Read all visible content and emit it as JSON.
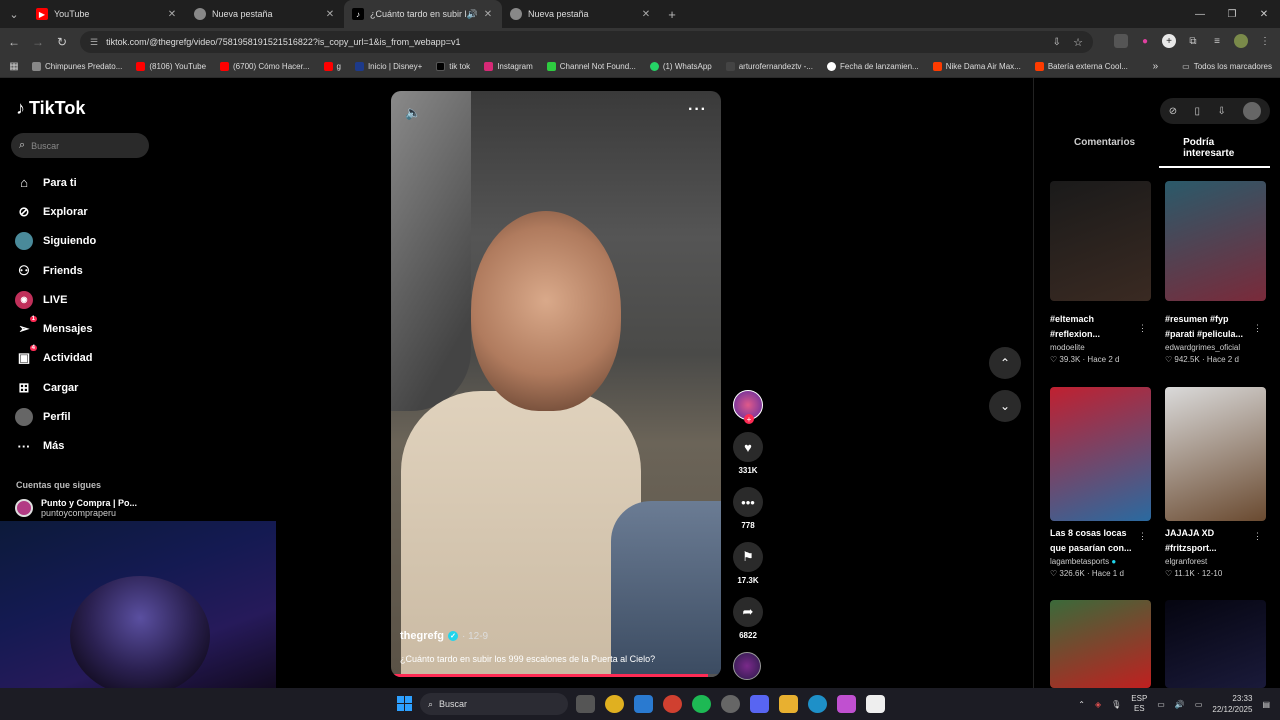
{
  "browser": {
    "tabs": [
      {
        "title": "YouTube",
        "icon": "youtube-icon",
        "active": false
      },
      {
        "title": "Nueva pestaña",
        "icon": "chrome-icon",
        "active": false
      },
      {
        "title": "¿Cuánto tardo en subir los",
        "icon": "tiktok-icon",
        "active": true
      },
      {
        "title": "Nueva pestaña",
        "icon": "chrome-icon",
        "active": false
      }
    ],
    "url": "tiktok.com/@thegrefg/video/7581958191521516822?is_copy_url=1&is_from_webapp=v1",
    "bookmarks": [
      {
        "label": "Chimpunes Predato...",
        "color": "#888888"
      },
      {
        "label": "(8106) YouTube",
        "color": "#ff0000"
      },
      {
        "label": "(6700) Cómo Hacer...",
        "color": "#ff0000"
      },
      {
        "label": "g",
        "color": "#ff0000"
      },
      {
        "label": "Inicio | Disney+",
        "color": "#1d3a8a"
      },
      {
        "label": "tik tok",
        "color": "#000000"
      },
      {
        "label": "Instagram",
        "color": "#d62976"
      },
      {
        "label": "Channel Not Found...",
        "color": "#2ecc40"
      },
      {
        "label": "(1) WhatsApp",
        "color": "#25d366"
      },
      {
        "label": "arturofernandeztv -...",
        "color": "#444444"
      },
      {
        "label": "Fecha de lanzamien...",
        "color": "#ffffff"
      },
      {
        "label": "Nike Dama Air Max...",
        "color": "#ff3b00"
      },
      {
        "label": "Batería externa Cool...",
        "color": "#ff3b00"
      }
    ],
    "all_bookmarks": "Todos los marcadores"
  },
  "sidebar": {
    "logo": "TikTok",
    "search_placeholder": "Buscar",
    "menu": [
      {
        "label": "Para ti",
        "icon": "home-icon",
        "badge": ""
      },
      {
        "label": "Explorar",
        "icon": "compass-icon",
        "badge": ""
      },
      {
        "label": "Siguiendo",
        "icon": "following-avatar-icon",
        "badge": ""
      },
      {
        "label": "Friends",
        "icon": "friends-icon",
        "badge": ""
      },
      {
        "label": "LIVE",
        "icon": "live-icon",
        "badge": ""
      },
      {
        "label": "Mensajes",
        "icon": "paper-plane-icon",
        "badge": "1"
      },
      {
        "label": "Actividad",
        "icon": "inbox-icon",
        "badge": "4"
      },
      {
        "label": "Cargar",
        "icon": "upload-icon",
        "badge": ""
      },
      {
        "label": "Perfil",
        "icon": "profile-avatar-icon",
        "badge": ""
      },
      {
        "label": "Más",
        "icon": "more-icon",
        "badge": ""
      }
    ],
    "following_heading": "Cuentas que sigues",
    "followed_account": {
      "name": "Punto y Compra | Po...",
      "handle": "puntoycompraperu"
    }
  },
  "video": {
    "author": "thegrefg",
    "date": "· 12-9",
    "caption": "¿Cuánto tardo en subir los 999 escalones de la Puerta al Cielo?",
    "progress": 0.96
  },
  "actions": {
    "likes": "331K",
    "comments": "778",
    "saves": "17.3K",
    "shares": "6822"
  },
  "right_panel": {
    "tabs": [
      {
        "label": "Comentarios",
        "active": false
      },
      {
        "label": "Podría interesarte",
        "active": true
      }
    ],
    "cards": [
      {
        "title": "#eltemach\n#reflexion...",
        "author": "modoelite",
        "likes": "39.3K",
        "time": "Hace 2 d",
        "verified": false,
        "colors": [
          "#1a1a1a",
          "#3a2a22"
        ]
      },
      {
        "title": "#resumen #fyp\n#parati #pelicula...",
        "author": "edwardgrimes_oficial",
        "likes": "942.5K",
        "time": "Hace 2 d",
        "verified": false,
        "colors": [
          "#2a5a6a",
          "#7a2a3a"
        ]
      },
      {
        "title": "Las 8 cosas locas\nque pasarían con...",
        "author": "lagambetasports",
        "likes": "326.6K",
        "time": "Hace 1 d",
        "verified": true,
        "colors": [
          "#c02030",
          "#2a6aa0"
        ]
      },
      {
        "title": "JAJAJA XD\n#fritzsport...",
        "author": "elgranforest",
        "likes": "11.1K",
        "time": "12-10",
        "verified": false,
        "colors": [
          "#dadada",
          "#6a4a30"
        ]
      },
      {
        "title": "",
        "author": "",
        "likes": "",
        "time": "",
        "verified": false,
        "colors": [
          "#3a6a3a",
          "#c02020"
        ]
      },
      {
        "title": "",
        "author": "",
        "likes": "",
        "time": "",
        "verified": false,
        "colors": [
          "#050510",
          "#1a1a3a"
        ]
      }
    ]
  },
  "taskbar": {
    "search_placeholder": "Buscar",
    "lang_top": "ESP",
    "lang_bottom": "ES",
    "time": "23:33",
    "date": "22/12/2025"
  }
}
